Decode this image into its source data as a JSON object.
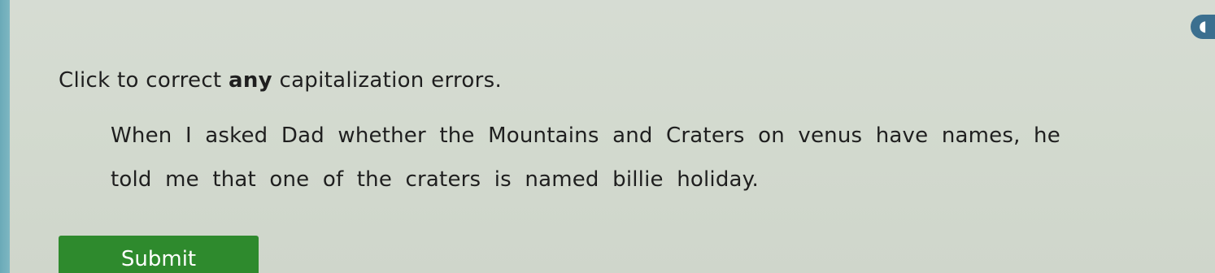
{
  "instruction": {
    "prefix": "Click to correct ",
    "emphasis": "any",
    "suffix": " capitalization errors."
  },
  "passage": {
    "line1": [
      "When",
      "I",
      "asked",
      "Dad",
      "whether",
      "the",
      "Mountains",
      "and",
      "Craters",
      "on",
      "venus",
      "have",
      "names,",
      "he"
    ],
    "line2": [
      "told",
      "me",
      "that",
      "one",
      "of",
      "the",
      "craters",
      "is",
      "named",
      "billie",
      "holiday."
    ]
  },
  "submit_label": "Submit",
  "colors": {
    "submit": "#2e8a2d",
    "accent_strip": "#7eb7c2"
  },
  "icons": {
    "corner": "partial-circle-icon"
  }
}
